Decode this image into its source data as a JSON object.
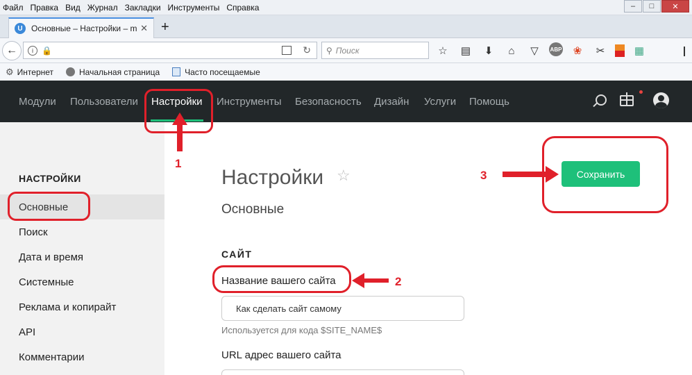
{
  "browser": {
    "menu": [
      "Файл",
      "Правка",
      "Вид",
      "Журнал",
      "Закладки",
      "Инструменты",
      "Справка"
    ],
    "tab": {
      "title": "Основные – Настройки – m",
      "favicon": "U"
    },
    "search_placeholder": "Поиск",
    "bookmarks": [
      "Интернет",
      "Начальная страница",
      "Часто посещаемые"
    ],
    "toolbar_icons": [
      "star-icon",
      "reading-list-icon",
      "download-icon",
      "home-icon",
      "pocket-icon",
      "abp-icon",
      "colors-icon",
      "scissors-icon",
      "flag-icon",
      "grid-app-icon"
    ],
    "abp_label": "ABP"
  },
  "nav": {
    "items": [
      "Модули",
      "Пользователи",
      "Настройки",
      "Инструменты",
      "Безопасность",
      "Дизайн",
      "Услуги",
      "Помощь"
    ],
    "active": "Настройки",
    "accent": "#1ec07a"
  },
  "sidebar": {
    "heading": "НАСТРОЙКИ",
    "items": [
      "Основные",
      "Поиск",
      "Дата и время",
      "Системные",
      "Реклама и копирайт",
      "API",
      "Комментарии"
    ]
  },
  "main": {
    "title": "Настройки",
    "subtitle": "Основные",
    "save_label": "Сохранить",
    "section": "САЙТ",
    "field1": {
      "label": "Название вашего сайта",
      "value": "Как сделать сайт самому",
      "hint": "Используется для кода $SITE_NAME$"
    },
    "field2": {
      "label": "URL адрес вашего сайта"
    }
  },
  "annotations": {
    "n1": "1",
    "n2": "2",
    "n3": "3",
    "color": "#e0202a"
  }
}
